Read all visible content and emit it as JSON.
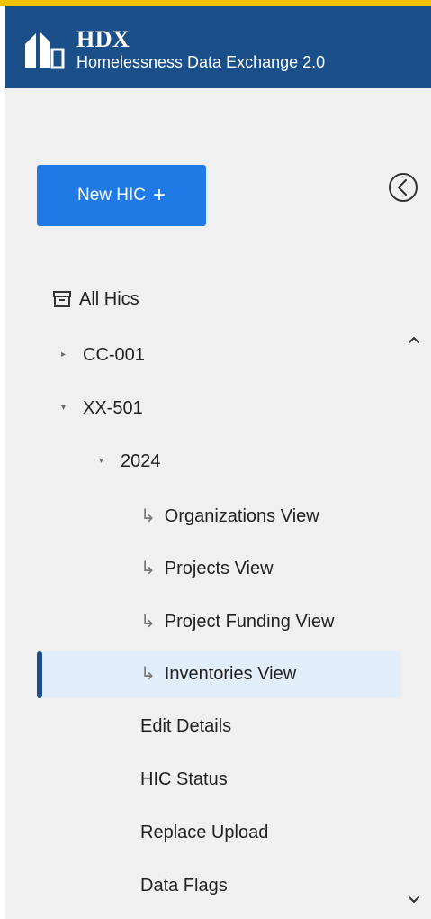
{
  "header": {
    "brand": "HDX",
    "subtitle": "Homelessness Data Exchange 2.0",
    "bg_color": "#1a4f8a",
    "accent_bar_color": "#f2c300"
  },
  "sidebar": {
    "new_button_label": "New HIC",
    "new_button_icon": "plus-icon",
    "collapse_icon": "chevron-left-circle-icon",
    "tree": {
      "root_label": "All Hics",
      "root_icon": "archive-icon",
      "coc_1": "CC-001",
      "coc_2": "XX-501",
      "year": "2024",
      "views": [
        "Organizations View",
        "Projects View",
        "Project Funding View",
        "Inventories View"
      ],
      "actions": [
        "Edit Details",
        "HIC Status",
        "Replace Upload",
        "Data Flags"
      ],
      "selected": "Inventories View"
    },
    "scroll_up_icon": "chevron-up-icon",
    "scroll_down_icon": "chevron-down-icon"
  }
}
